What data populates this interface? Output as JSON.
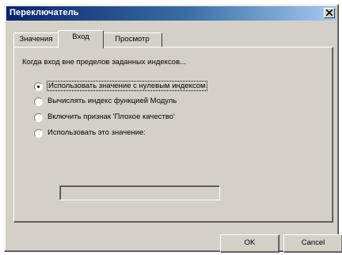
{
  "window": {
    "title": "Переключатель",
    "close_icon": "close-icon"
  },
  "tabs": [
    {
      "label": "Значения",
      "active": false
    },
    {
      "label": "Вход",
      "active": true
    },
    {
      "label": "Просмотр",
      "active": false
    }
  ],
  "panel": {
    "heading": "Когда вход вне пределов заданных индексов...",
    "options": [
      {
        "label": "Использовать значение с нулевым индексом",
        "checked": true
      },
      {
        "label": "Вычислять индекс функцией Модуль",
        "checked": false
      },
      {
        "label": "Включить признак 'Плохое качество'",
        "checked": false
      },
      {
        "label": "Использовать это значение:",
        "checked": false
      }
    ],
    "value_input": {
      "value": ""
    }
  },
  "buttons": {
    "ok": "OK",
    "cancel": "Cancel"
  }
}
